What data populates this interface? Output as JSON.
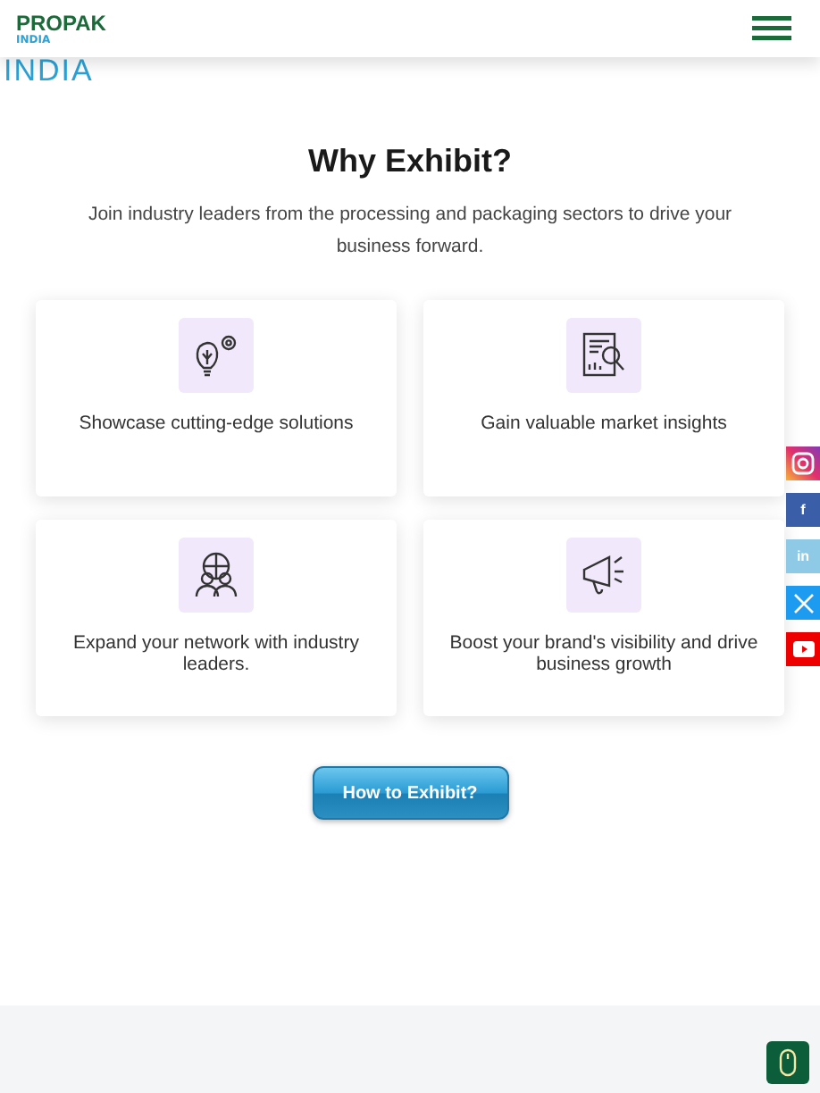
{
  "header": {
    "logo_top": "PROPAK",
    "logo_bottom": "INDIA"
  },
  "banner_text": "INDIA",
  "section": {
    "title": "Why Exhibit?",
    "subtitle": "Join industry leaders from the processing and packaging sectors to drive your business forward."
  },
  "cards": [
    {
      "kind": "idea",
      "text": "Showcase cutting-edge solutions"
    },
    {
      "kind": "report",
      "text": "Gain valuable market insights"
    },
    {
      "kind": "network",
      "text": "Expand your network with industry leaders."
    },
    {
      "kind": "megaphone",
      "text": "Boost your brand's visibility and drive business growth"
    }
  ],
  "button": "How to Exhibit?",
  "social": [
    {
      "kind": "instagram"
    },
    {
      "kind": "facebook",
      "glyph": "f"
    },
    {
      "kind": "linkedin",
      "glyph": "in"
    },
    {
      "kind": "x"
    },
    {
      "kind": "youtube"
    }
  ]
}
